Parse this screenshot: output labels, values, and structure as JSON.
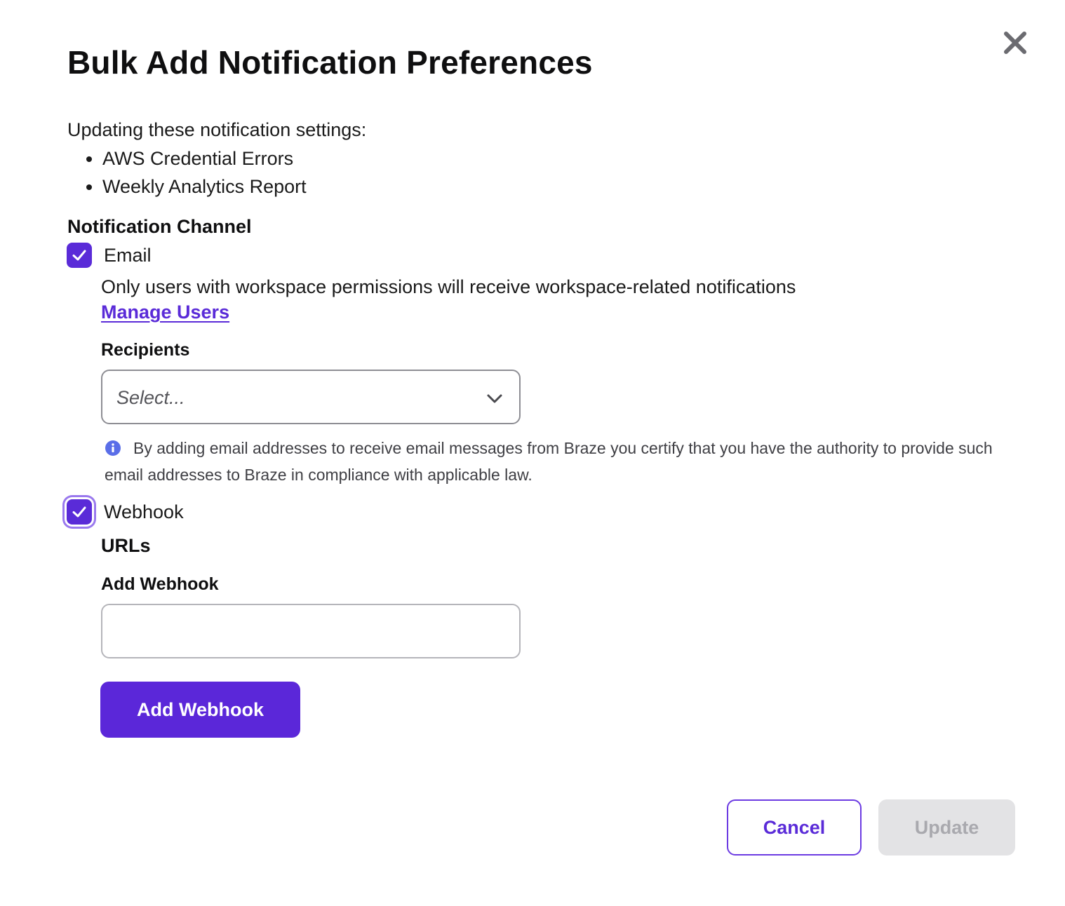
{
  "dialog": {
    "title": "Bulk Add Notification Preferences",
    "close_icon": "close-icon"
  },
  "intro": {
    "text": "Updating these notification settings:",
    "settings": [
      "AWS Credential Errors",
      "Weekly Analytics Report"
    ]
  },
  "channel": {
    "label": "Notification Channel",
    "email": {
      "label": "Email",
      "checked": true,
      "helper_text": "Only users with workspace permissions will receive workspace-related notifications",
      "manage_link": "Manage Users",
      "recipients_label": "Recipients",
      "recipients_placeholder": "Select...",
      "notice": "By adding email addresses to receive email messages from Braze you certify that you have the authority to provide such email addresses to Braze in compliance with applicable law."
    },
    "webhook": {
      "label": "Webhook",
      "checked": true,
      "urls_label": "URLs",
      "add_label": "Add Webhook",
      "input_value": "",
      "add_button": "Add Webhook"
    }
  },
  "footer": {
    "cancel": "Cancel",
    "update": "Update"
  },
  "colors": {
    "accent": "#5a2bd8",
    "disabled_bg": "#e3e3e5",
    "disabled_text": "#a9a9ae"
  }
}
